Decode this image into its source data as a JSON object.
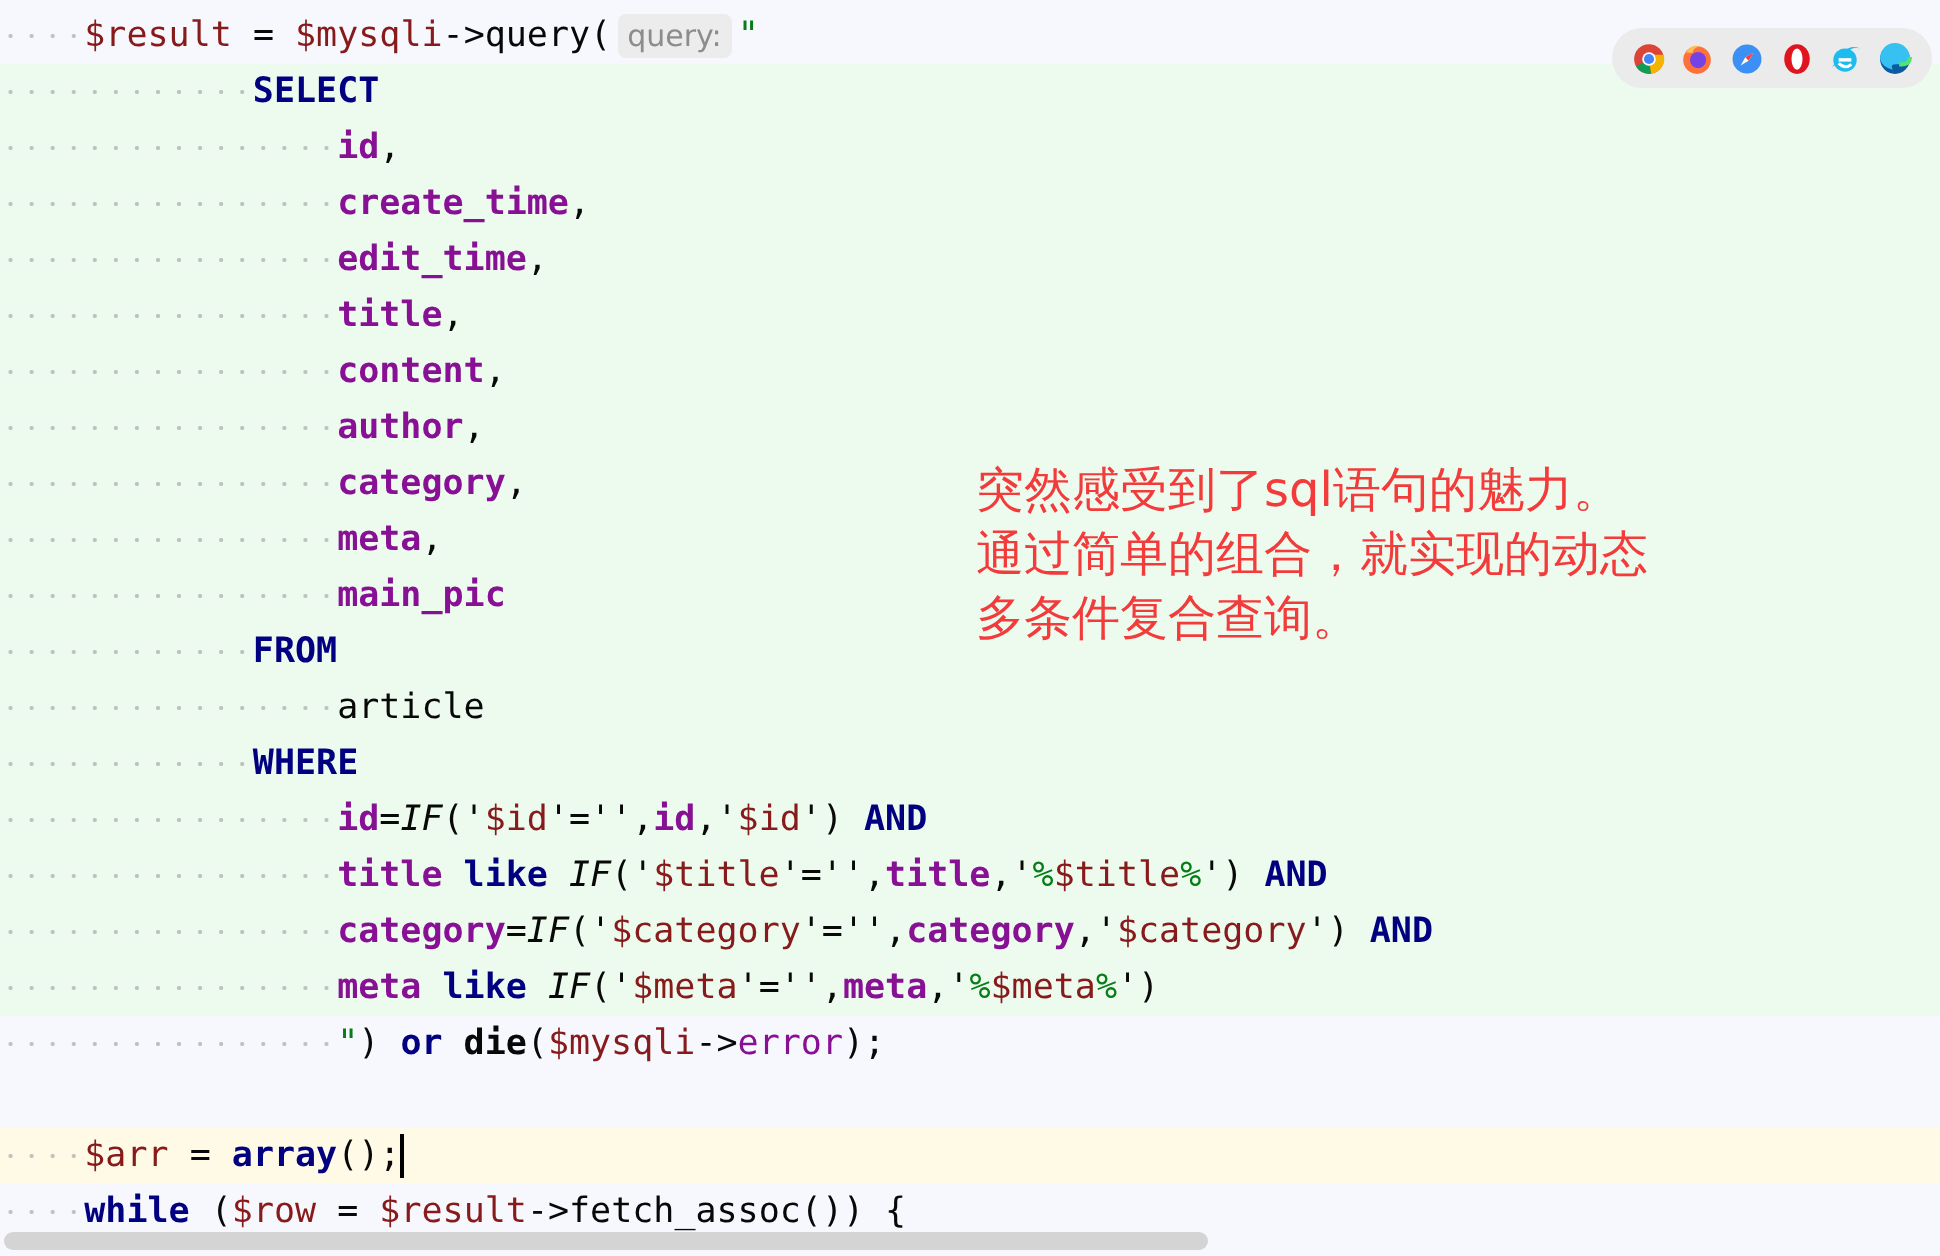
{
  "browser_icons": [
    {
      "kind": "chrome"
    },
    {
      "kind": "firefox"
    },
    {
      "kind": "safari"
    },
    {
      "kind": "opera"
    },
    {
      "kind": "ie"
    },
    {
      "kind": "edge"
    }
  ],
  "annotation": [
    "突然感受到了sql语句的魅力。",
    "通过简单的组合，就实现的动态",
    "多条件复合查询。"
  ],
  "lines": [
    {
      "kind": "php",
      "injected": false,
      "current": false,
      "tokens": [
        {
          "kind": "var",
          "text": "$result"
        },
        {
          "kind": "plain",
          "text": " = "
        },
        {
          "kind": "var",
          "text": "$mysqli"
        },
        {
          "kind": "plain",
          "text": "->query("
        },
        {
          "kind": "hint",
          "text": "query:"
        },
        {
          "kind": "string",
          "text": "\""
        }
      ]
    },
    {
      "kind": "clause",
      "injected": true,
      "current": false,
      "tokens": [
        {
          "kind": "keyword",
          "text": "SELECT"
        }
      ]
    },
    {
      "kind": "item",
      "injected": true,
      "current": false,
      "tokens": [
        {
          "kind": "field",
          "text": "id"
        },
        {
          "kind": "plain",
          "text": ","
        }
      ]
    },
    {
      "kind": "item",
      "injected": true,
      "current": false,
      "tokens": [
        {
          "kind": "field",
          "text": "create_time"
        },
        {
          "kind": "plain",
          "text": ","
        }
      ]
    },
    {
      "kind": "item",
      "injected": true,
      "current": false,
      "tokens": [
        {
          "kind": "field",
          "text": "edit_time"
        },
        {
          "kind": "plain",
          "text": ","
        }
      ]
    },
    {
      "kind": "item",
      "injected": true,
      "current": false,
      "tokens": [
        {
          "kind": "field",
          "text": "title"
        },
        {
          "kind": "plain",
          "text": ","
        }
      ]
    },
    {
      "kind": "item",
      "injected": true,
      "current": false,
      "tokens": [
        {
          "kind": "field",
          "text": "content"
        },
        {
          "kind": "plain",
          "text": ","
        }
      ]
    },
    {
      "kind": "item",
      "injected": true,
      "current": false,
      "tokens": [
        {
          "kind": "field",
          "text": "author"
        },
        {
          "kind": "plain",
          "text": ","
        }
      ]
    },
    {
      "kind": "item",
      "injected": true,
      "current": false,
      "tokens": [
        {
          "kind": "field",
          "text": "category"
        },
        {
          "kind": "plain",
          "text": ","
        }
      ]
    },
    {
      "kind": "item",
      "injected": true,
      "current": false,
      "tokens": [
        {
          "kind": "field",
          "text": "meta"
        },
        {
          "kind": "plain",
          "text": ","
        }
      ]
    },
    {
      "kind": "item",
      "injected": true,
      "current": false,
      "tokens": [
        {
          "kind": "field",
          "text": "main_pic"
        }
      ]
    },
    {
      "kind": "clause",
      "injected": true,
      "current": false,
      "tokens": [
        {
          "kind": "keyword",
          "text": "FROM"
        }
      ]
    },
    {
      "kind": "item",
      "injected": true,
      "current": false,
      "tokens": [
        {
          "kind": "plain",
          "text": "article"
        }
      ]
    },
    {
      "kind": "clause",
      "injected": true,
      "current": false,
      "tokens": [
        {
          "kind": "keyword",
          "text": "WHERE"
        }
      ]
    },
    {
      "kind": "item",
      "injected": true,
      "current": false,
      "tokens": [
        {
          "kind": "field",
          "text": "id"
        },
        {
          "kind": "plain",
          "text": "="
        },
        {
          "kind": "italic",
          "text": "IF"
        },
        {
          "kind": "plain",
          "text": "('"
        },
        {
          "kind": "var",
          "text": "$id"
        },
        {
          "kind": "plain",
          "text": "'='',"
        },
        {
          "kind": "field",
          "text": "id"
        },
        {
          "kind": "plain",
          "text": ",'"
        },
        {
          "kind": "var",
          "text": "$id"
        },
        {
          "kind": "plain",
          "text": "') "
        },
        {
          "kind": "keyword",
          "text": "AND"
        }
      ]
    },
    {
      "kind": "item",
      "injected": true,
      "current": false,
      "tokens": [
        {
          "kind": "field",
          "text": "title"
        },
        {
          "kind": "keyword",
          "text": " like "
        },
        {
          "kind": "italic",
          "text": "IF"
        },
        {
          "kind": "plain",
          "text": "('"
        },
        {
          "kind": "var",
          "text": "$title"
        },
        {
          "kind": "plain",
          "text": "'='',"
        },
        {
          "kind": "field",
          "text": "title"
        },
        {
          "kind": "plain",
          "text": ",'"
        },
        {
          "kind": "string",
          "text": "%"
        },
        {
          "kind": "var",
          "text": "$title"
        },
        {
          "kind": "string",
          "text": "%"
        },
        {
          "kind": "plain",
          "text": "') "
        },
        {
          "kind": "keyword",
          "text": "AND"
        }
      ]
    },
    {
      "kind": "item",
      "injected": true,
      "current": false,
      "tokens": [
        {
          "kind": "field",
          "text": "category"
        },
        {
          "kind": "plain",
          "text": "="
        },
        {
          "kind": "italic",
          "text": "IF"
        },
        {
          "kind": "plain",
          "text": "('"
        },
        {
          "kind": "var",
          "text": "$category"
        },
        {
          "kind": "plain",
          "text": "'='',"
        },
        {
          "kind": "field",
          "text": "category"
        },
        {
          "kind": "plain",
          "text": ",'"
        },
        {
          "kind": "var",
          "text": "$category"
        },
        {
          "kind": "plain",
          "text": "') "
        },
        {
          "kind": "keyword",
          "text": "AND"
        }
      ]
    },
    {
      "kind": "item",
      "injected": true,
      "current": false,
      "tokens": [
        {
          "kind": "field",
          "text": "meta"
        },
        {
          "kind": "keyword",
          "text": " like "
        },
        {
          "kind": "italic",
          "text": "IF"
        },
        {
          "kind": "plain",
          "text": "('"
        },
        {
          "kind": "var",
          "text": "$meta"
        },
        {
          "kind": "plain",
          "text": "'='',"
        },
        {
          "kind": "field",
          "text": "meta"
        },
        {
          "kind": "plain",
          "text": ",'"
        },
        {
          "kind": "string",
          "text": "%"
        },
        {
          "kind": "var",
          "text": "$meta"
        },
        {
          "kind": "string",
          "text": "%"
        },
        {
          "kind": "plain",
          "text": "')"
        }
      ]
    },
    {
      "kind": "item",
      "injected": false,
      "current": false,
      "tokens": [
        {
          "kind": "string",
          "text": "\""
        },
        {
          "kind": "plain",
          "text": ") "
        },
        {
          "kind": "keyword",
          "text": "or "
        },
        {
          "kind": "bold",
          "text": "die"
        },
        {
          "kind": "plain",
          "text": "("
        },
        {
          "kind": "var",
          "text": "$mysqli"
        },
        {
          "kind": "plain",
          "text": "->"
        },
        {
          "kind": "prop",
          "text": "error"
        },
        {
          "kind": "plain",
          "text": ");"
        }
      ]
    },
    {
      "kind": "blank",
      "injected": false,
      "current": false
    },
    {
      "kind": "php",
      "injected": false,
      "current": true,
      "tokens": [
        {
          "kind": "var",
          "text": "$arr"
        },
        {
          "kind": "plain",
          "text": " = "
        },
        {
          "kind": "keyword",
          "text": "array"
        },
        {
          "kind": "plain",
          "text": "();"
        }
      ]
    },
    {
      "kind": "php",
      "injected": false,
      "current": false,
      "tokens": [
        {
          "kind": "keyword",
          "text": "while"
        },
        {
          "kind": "plain",
          "text": " ("
        },
        {
          "kind": "var",
          "text": "$row"
        },
        {
          "kind": "plain",
          "text": " = "
        },
        {
          "kind": "var",
          "text": "$result"
        },
        {
          "kind": "plain",
          "text": "->fetch_assoc()) {"
        }
      ]
    }
  ]
}
